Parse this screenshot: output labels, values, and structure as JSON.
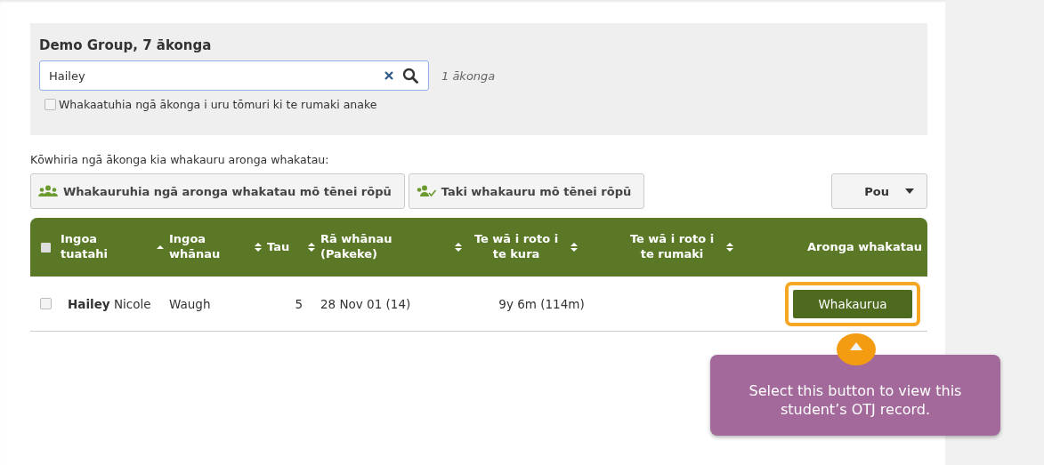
{
  "filter": {
    "title": "Demo Group, 7 ākonga",
    "search": {
      "value": "Hailey"
    },
    "result_count": "1 ākonga",
    "checkbox": {
      "label": "Whakaatuhia ngā ākonga i uru tōmuri ki te rumaki anake",
      "checked": false
    }
  },
  "instruction": "Kōwhiria ngā ākonga kia whakauru aronga whakatau:",
  "actions": [
    {
      "label": "Whakauruhia ngā aronga whakatau mō tēnei rōpū",
      "kind": "group"
    },
    {
      "label": "Taki whakauru mō tēnei rōpū",
      "kind": "check"
    }
  ],
  "columns_button": {
    "label": "Pou"
  },
  "table": {
    "select_all": {
      "checked": false
    },
    "columns": [
      {
        "label": "Ingoa tuatahi",
        "sortable": true,
        "sorted": true
      },
      {
        "label": "Ingoa whānau",
        "sortable": true,
        "sorted": false
      },
      {
        "label": "Tau",
        "sortable": true,
        "sorted": false
      },
      {
        "label": "Rā whānau (Pakeke)",
        "sortable": true,
        "sorted": false
      },
      {
        "label": "Te wā i roto i te kura",
        "sortable": true,
        "sorted": false
      },
      {
        "label": "Te wā i roto i te rumaki",
        "sortable": true,
        "sorted": false
      },
      {
        "label": "Aronga whakatau"
      }
    ],
    "rows": [
      {
        "checked": false,
        "cells": [
          "**Hailey** Nicole",
          "Waugh",
          "5",
          "28 Nov 01 (14)",
          "9y 6m (114m)",
          ""
        ],
        "button": "Whakaurua",
        "highlighted": true
      }
    ]
  },
  "tooltip": {
    "text": "Select this button to view this student’s OTJ record."
  }
}
